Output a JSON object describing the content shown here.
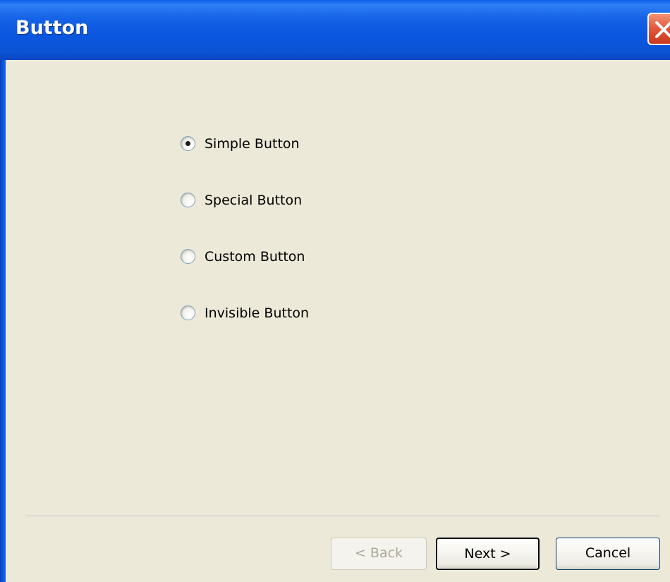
{
  "window": {
    "title": "Button"
  },
  "options": {
    "items": [
      {
        "label": "Simple Button",
        "selected": true
      },
      {
        "label": "Special Button",
        "selected": false
      },
      {
        "label": "Custom Button",
        "selected": false
      },
      {
        "label": "Invisible Button",
        "selected": false
      }
    ]
  },
  "footer": {
    "back_label": "< Back",
    "back_enabled": false,
    "next_label": "Next >",
    "cancel_label": "Cancel"
  },
  "colors": {
    "titlebar": "#0a56df",
    "dialog_bg": "#ece9d8",
    "close_button": "#e2563a",
    "disabled_text": "#aca899"
  },
  "icons": {
    "close": "close-icon"
  }
}
